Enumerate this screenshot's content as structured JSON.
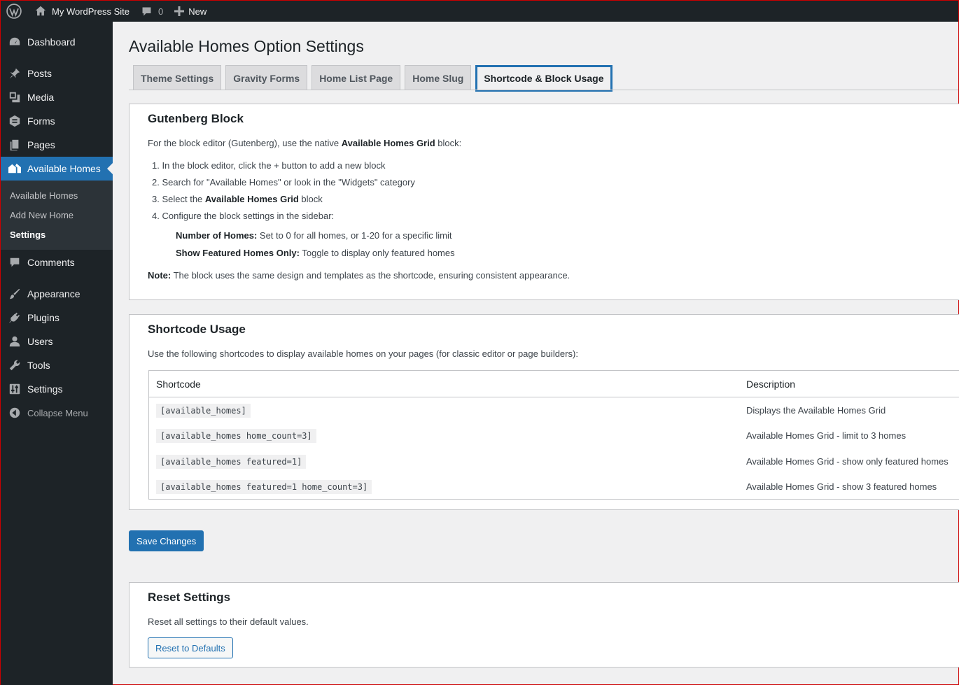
{
  "adminbar": {
    "site_name": "My WordPress Site",
    "comments_count": "0",
    "new_label": "New"
  },
  "sidebar": {
    "items": [
      {
        "label": "Dashboard",
        "icon": "dashboard-icon"
      },
      {
        "label": "Posts",
        "icon": "pin-icon"
      },
      {
        "label": "Media",
        "icon": "media-icon"
      },
      {
        "label": "Forms",
        "icon": "forms-icon"
      },
      {
        "label": "Pages",
        "icon": "pages-icon"
      },
      {
        "label": "Available Homes",
        "icon": "homes-icon"
      },
      {
        "label": "Comments",
        "icon": "comment-icon"
      },
      {
        "label": "Appearance",
        "icon": "brush-icon"
      },
      {
        "label": "Plugins",
        "icon": "plug-icon"
      },
      {
        "label": "Users",
        "icon": "user-icon"
      },
      {
        "label": "Tools",
        "icon": "wrench-icon"
      },
      {
        "label": "Settings",
        "icon": "sliders-icon"
      }
    ],
    "submenu": [
      "Available Homes",
      "Add New Home",
      "Settings"
    ],
    "collapse_label": "Collapse Menu"
  },
  "page": {
    "title": "Available Homes Option Settings",
    "tabs": [
      "Theme Settings",
      "Gravity Forms",
      "Home List Page",
      "Home Slug",
      "Shortcode & Block Usage"
    ],
    "active_tab": "Shortcode & Block Usage"
  },
  "gutenberg": {
    "heading": "Gutenberg Block",
    "intro_before": "For the block editor (Gutenberg), use the native ",
    "intro_bold": "Available Homes Grid",
    "intro_after": " block:",
    "step1": "In the block editor, click the + button to add a new block",
    "step2": "Search for \"Available Homes\" or look in the \"Widgets\" category",
    "step3_before": "Select the ",
    "step3_bold": "Available Homes Grid",
    "step3_after": " block",
    "step4": "Configure the block settings in the sidebar:",
    "setting1_label": "Number of Homes:",
    "setting1_text": " Set to 0 for all homes, or 1-20 for a specific limit",
    "setting2_label": "Show Featured Homes Only:",
    "setting2_text": " Toggle to display only featured homes",
    "note_label": "Note:",
    "note_text": " The block uses the same design and templates as the shortcode, ensuring consistent appearance."
  },
  "shortcodes": {
    "heading": "Shortcode Usage",
    "intro": "Use the following shortcodes to display available homes on your pages (for classic editor or page builders):",
    "col_shortcode": "Shortcode",
    "col_description": "Description",
    "rows": [
      {
        "code": "[available_homes]",
        "desc": "Displays the Available Homes Grid"
      },
      {
        "code": "[available_homes home_count=3]",
        "desc": "Available Homes Grid - limit to 3 homes"
      },
      {
        "code": "[available_homes featured=1]",
        "desc": "Available Homes Grid - show only featured homes"
      },
      {
        "code": "[available_homes featured=1 home_count=3]",
        "desc": "Available Homes Grid - show 3 featured homes"
      }
    ]
  },
  "save_label": "Save Changes",
  "reset": {
    "heading": "Reset Settings",
    "text": "Reset all settings to their default values.",
    "button": "Reset to Defaults"
  },
  "colors": {
    "accent": "#2271b1",
    "sidebar": "#1d2327",
    "submenu": "#2c3338"
  }
}
